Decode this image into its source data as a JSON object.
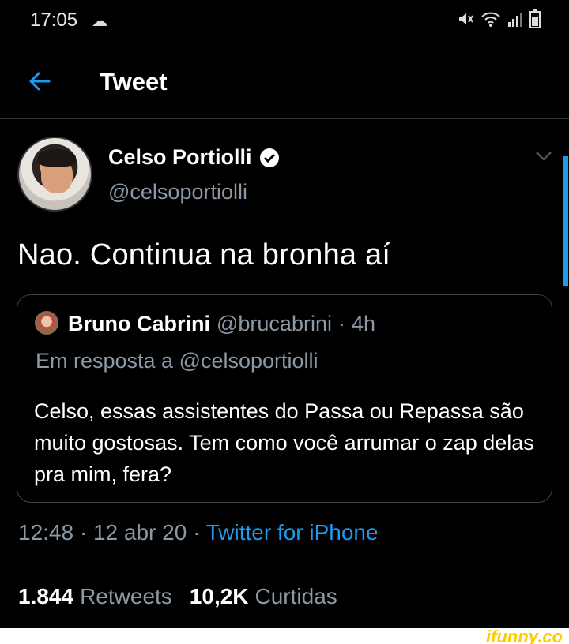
{
  "status_bar": {
    "time": "17:05",
    "weather_icon": "weather-icon",
    "icons": [
      "mute-icon",
      "wifi-icon",
      "signal-icon",
      "battery-icon"
    ]
  },
  "header": {
    "title": "Tweet",
    "back_icon": "back-arrow-icon"
  },
  "tweet": {
    "author_name": "Celso Portiolli",
    "author_handle": "@celsoportiolli",
    "verified": true,
    "text": "Nao. Continua na bronha aí",
    "quote": {
      "name": "Bruno Cabrini",
      "handle": "@brucabrini",
      "age": "4h",
      "reply_to": "Em resposta a @celsoportiolli",
      "text": "Celso, essas assistentes do Passa ou Repassa são muito gostosas. Tem como você arrumar o zap delas pra mim, fera?"
    },
    "time": "12:48",
    "date": "12 abr 20",
    "source": "Twitter for iPhone",
    "retweets": "1.844",
    "retweets_label": "Retweets",
    "likes": "10,2K",
    "likes_label": "Curtidas"
  },
  "watermark": "ifunny.co",
  "colors": {
    "accent": "#1d9bf0",
    "secondary_text": "#8b98a5",
    "background": "#000000"
  }
}
